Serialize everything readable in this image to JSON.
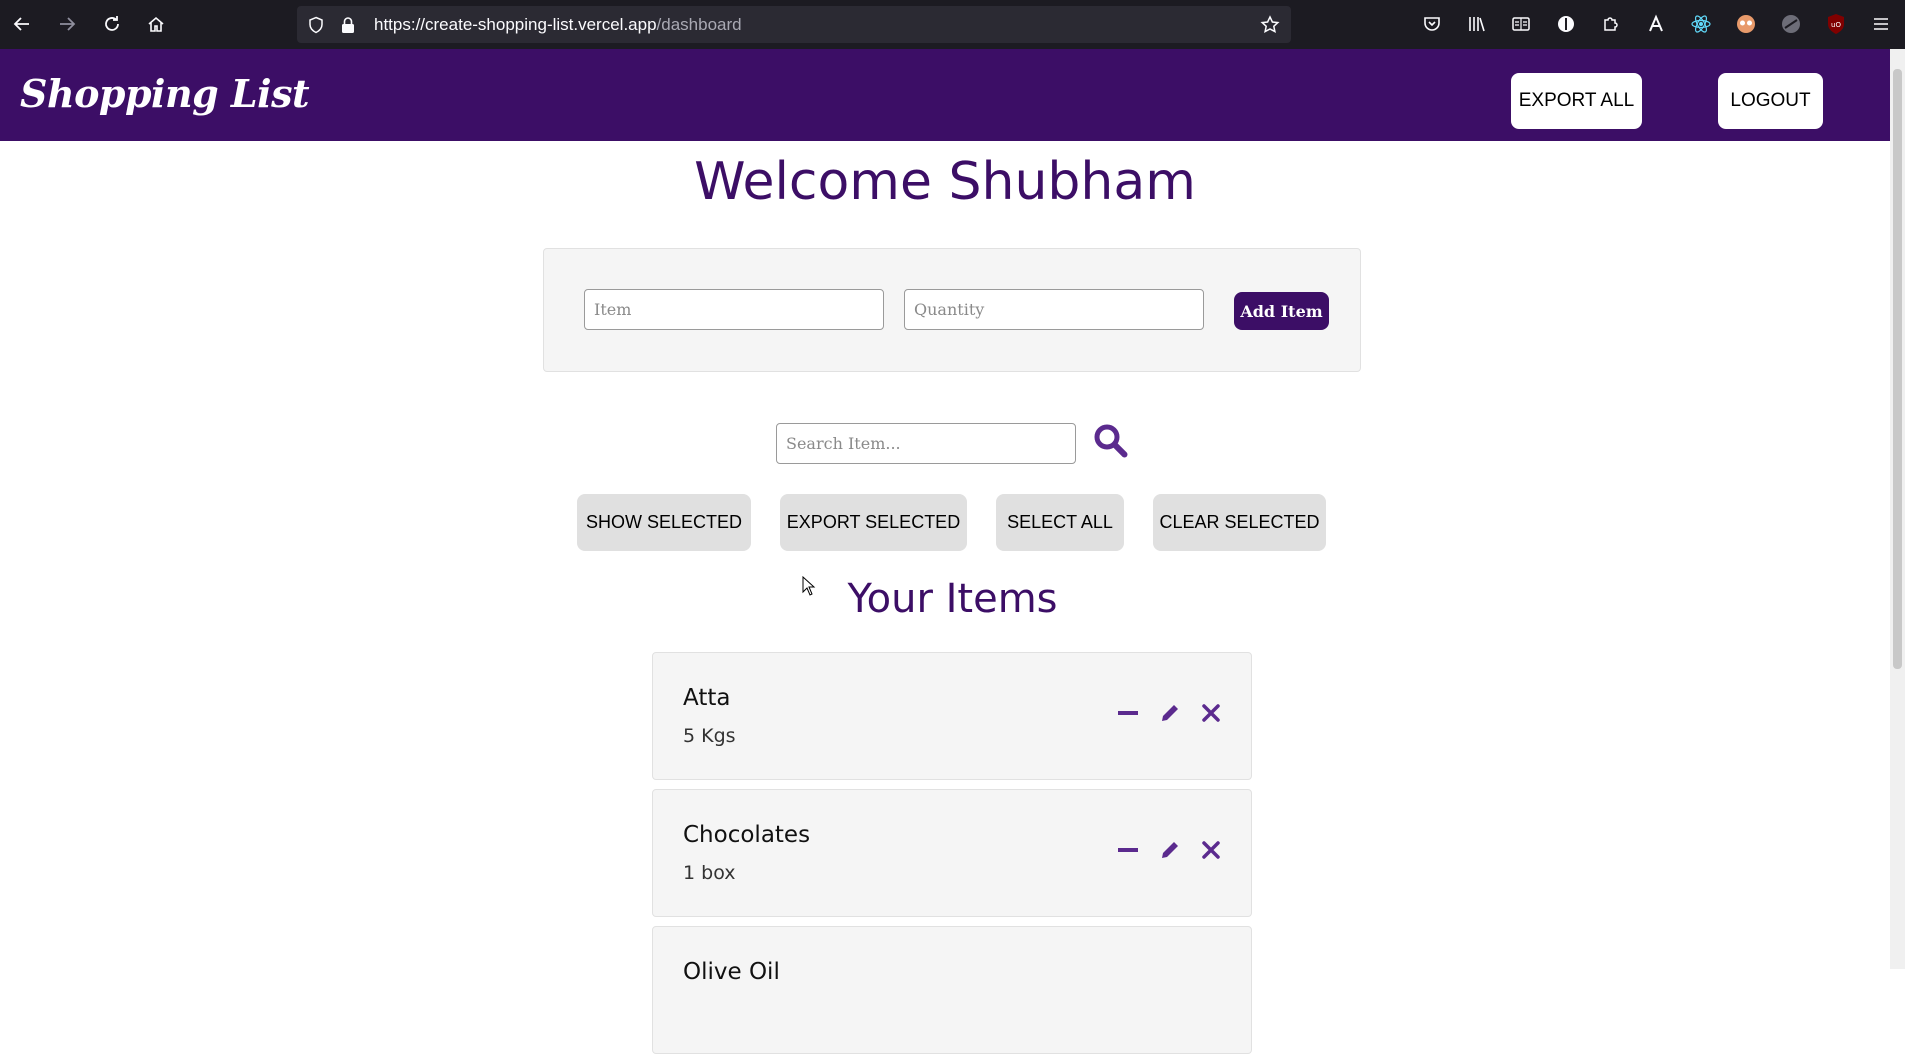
{
  "browser": {
    "url_host": "https://create-shopping-list.vercel.app",
    "url_path": "/dashboard"
  },
  "header": {
    "logo": "Shopping List",
    "export_all_label": "EXPORT ALL",
    "logout_label": "LOGOUT"
  },
  "welcome": "Welcome Shubham",
  "add_form": {
    "item_placeholder": "Item",
    "quantity_placeholder": "Quantity",
    "add_label": "Add Item"
  },
  "search": {
    "placeholder": "Search Item..."
  },
  "actions": {
    "show_selected": "SHOW SELECTED",
    "export_selected": "EXPORT SELECTED",
    "select_all": "SELECT ALL",
    "clear_selected": "CLEAR SELECTED"
  },
  "items_heading": "Your Items",
  "items": [
    {
      "name": "Atta",
      "qty": "5 Kgs"
    },
    {
      "name": "Chocolates",
      "qty": "1 box"
    },
    {
      "name": "Olive Oil",
      "qty": ""
    }
  ],
  "colors": {
    "brand": "#3c0e66",
    "icon_purple": "#5b2a8e"
  }
}
